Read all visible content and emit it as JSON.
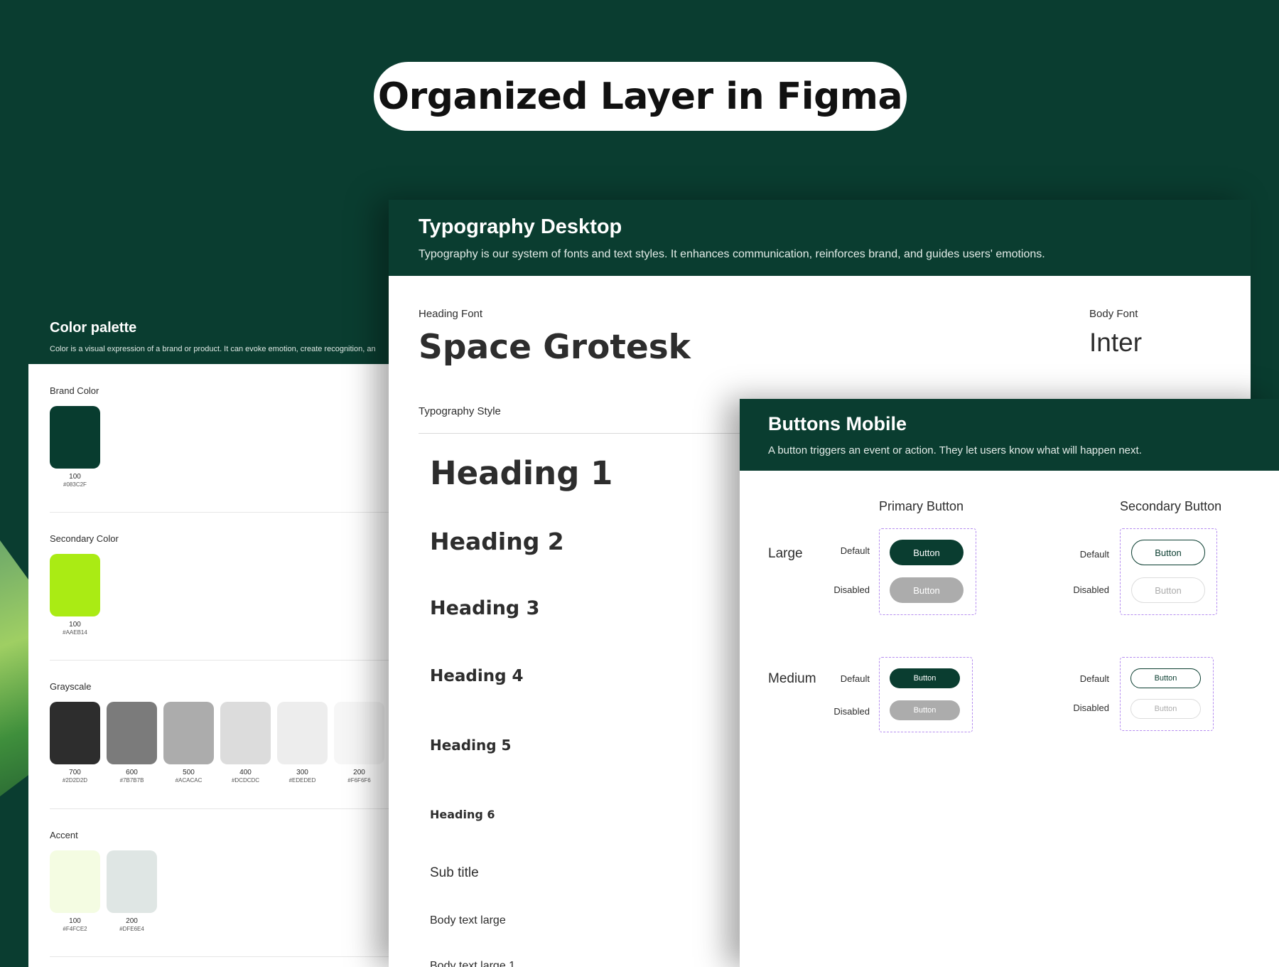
{
  "header": {
    "title": "Organized Layer in Figma"
  },
  "palette": {
    "title": "Color palette",
    "description": "Color is a visual expression of a brand or product. It can evoke emotion, create recognition, an",
    "brand": {
      "label": "Brand Color",
      "swatches": [
        {
          "shade": "100",
          "hex": "#083C2F",
          "color": "#083C2F"
        }
      ]
    },
    "secondary": {
      "label": "Secondary Color",
      "swatches": [
        {
          "shade": "100",
          "hex": "#AAEB14",
          "color": "#AAEB14"
        }
      ]
    },
    "grayscale": {
      "label": "Grayscale",
      "swatches": [
        {
          "shade": "700",
          "hex": "#2D2D2D",
          "color": "#2D2D2D"
        },
        {
          "shade": "600",
          "hex": "#7B7B7B",
          "color": "#7B7B7B"
        },
        {
          "shade": "500",
          "hex": "#ACACAC",
          "color": "#ACACAC"
        },
        {
          "shade": "400",
          "hex": "#DCDCDC",
          "color": "#DCDCDC"
        },
        {
          "shade": "300",
          "hex": "#EDEDED",
          "color": "#EDEDED"
        },
        {
          "shade": "200",
          "hex": "#F6F6F6",
          "color": "#F6F6F6"
        }
      ]
    },
    "accent": {
      "label": "Accent",
      "swatches": [
        {
          "shade": "100",
          "hex": "#F4FCE2",
          "color": "#F4FCE2"
        },
        {
          "shade": "200",
          "hex": "#DFE6E4",
          "color": "#DFE6E4"
        }
      ]
    }
  },
  "typography": {
    "title": "Typography Desktop",
    "description": "Typography is our system of fonts and text styles. It enhances communication, reinforces brand, and guides users' emotions.",
    "heading_font_label": "Heading Font",
    "heading_font": "Space Grotesk",
    "body_font_label": "Body Font",
    "body_font": "Inter",
    "style_label": "Typography Style",
    "styles": {
      "h1": "Heading 1",
      "h2": "Heading 2",
      "h3": "Heading 3",
      "h4": "Heading 4",
      "h5": "Heading 5",
      "h6": "Heading 6",
      "subtitle": "Sub title",
      "body_large": "Body text large",
      "body_cut": "Body text large 1"
    }
  },
  "buttons": {
    "title": "Buttons Mobile",
    "description": "A button triggers an event or action. They let users know what will happen next.",
    "primary_col": "Primary Button",
    "secondary_col": "Secondary Button",
    "sizes": {
      "large": "Large",
      "medium": "Medium"
    },
    "states": {
      "default": "Default",
      "disabled": "Disabled"
    },
    "button_label": "Button"
  },
  "colors": {
    "brand": "#0A3D30",
    "focus_outline": "#B58DF0"
  }
}
